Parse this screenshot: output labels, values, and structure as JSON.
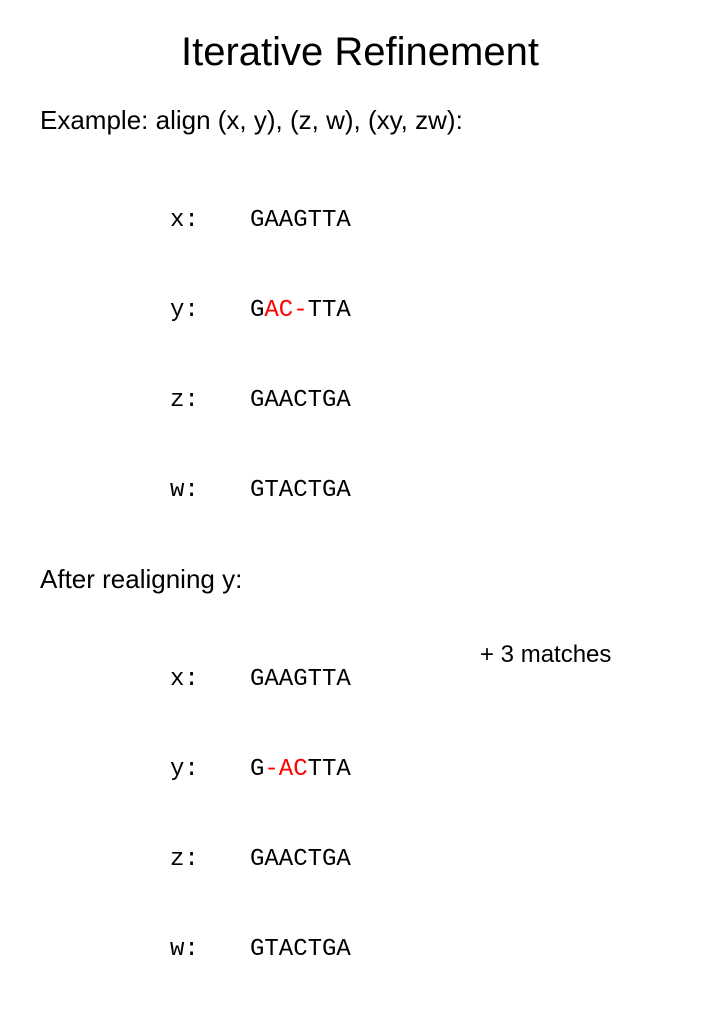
{
  "title": "Iterative Refinement",
  "example_line": "Example: align (x, y), (z, w), (xy, zw):",
  "block1": {
    "rows": [
      {
        "label": "x:",
        "pre": "GAAGTTA",
        "red": "",
        "post": ""
      },
      {
        "label": "y:",
        "pre": "G",
        "red": "AC-",
        "post": "TTA"
      },
      {
        "label": "z:",
        "pre": "GAACTGA",
        "red": "",
        "post": ""
      },
      {
        "label": "w:",
        "pre": "GTACTGA",
        "red": "",
        "post": ""
      }
    ]
  },
  "after_line": "After realigning y:",
  "block2": {
    "rows": [
      {
        "label": "x:",
        "pre": "GAAGTTA",
        "red": "",
        "post": ""
      },
      {
        "label": "y:",
        "pre": "G",
        "red": "-AC",
        "post": "TTA"
      },
      {
        "label": "z:",
        "pre": "GAACTGA",
        "red": "",
        "post": ""
      },
      {
        "label": "w:",
        "pre": "GTACTGA",
        "red": "",
        "post": ""
      }
    ]
  },
  "matches_note": "+ 3 matches"
}
